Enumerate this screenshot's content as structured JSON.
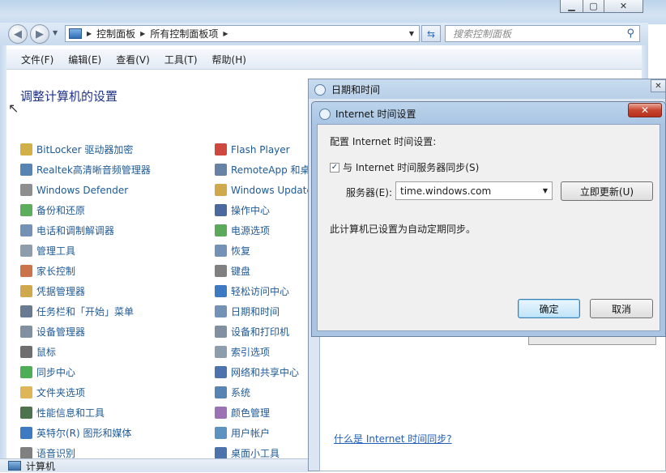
{
  "explorer": {
    "address_parts": [
      "控制面板",
      "所有控制面板项"
    ],
    "search_placeholder": "搜索控制面板",
    "menu": [
      "文件(F)",
      "编辑(E)",
      "查看(V)",
      "工具(T)",
      "帮助(H)"
    ],
    "page_title": "调整计算机的设置",
    "col1": [
      {
        "label": "BitLocker 驱动器加密",
        "icon": "key-icon",
        "color": "#c9a227"
      },
      {
        "label": "Realtek高清晰音频管理器",
        "icon": "speaker-icon",
        "color": "#3a6ea5"
      },
      {
        "label": "Windows Defender",
        "icon": "castle-icon",
        "color": "#7a7a7a"
      },
      {
        "label": "备份和还原",
        "icon": "backup-icon",
        "color": "#3f9f3f"
      },
      {
        "label": "电话和调制解调器",
        "icon": "modem-icon",
        "color": "#5a7fa8"
      },
      {
        "label": "管理工具",
        "icon": "tools-icon",
        "color": "#7a8c9e"
      },
      {
        "label": "家长控制",
        "icon": "parental-icon",
        "color": "#c25a2a"
      },
      {
        "label": "凭据管理器",
        "icon": "vault-icon",
        "color": "#c79a2c"
      },
      {
        "label": "任务栏和「开始」菜单",
        "icon": "taskbar-icon",
        "color": "#4d6480"
      },
      {
        "label": "设备管理器",
        "icon": "device-manager-icon",
        "color": "#6b7d8f"
      },
      {
        "label": "鼠标",
        "icon": "mouse-icon",
        "color": "#555555"
      },
      {
        "label": "同步中心",
        "icon": "sync-icon",
        "color": "#2f9f3a"
      },
      {
        "label": "文件夹选项",
        "icon": "folder-icon",
        "color": "#d8a93a"
      },
      {
        "label": "性能信息和工具",
        "icon": "performance-icon",
        "color": "#2d5b2d"
      },
      {
        "label": "英特尔(R) 图形和媒体",
        "icon": "intel-icon",
        "color": "#1c63b7"
      },
      {
        "label": "语音识别",
        "icon": "microphone-icon",
        "color": "#6a6a6a"
      }
    ],
    "col2": [
      {
        "label": "Flash Player",
        "icon": "flash-icon",
        "color": "#c4281c"
      },
      {
        "label": "RemoteApp 和桌",
        "icon": "remoteapp-icon",
        "color": "#4e6c95"
      },
      {
        "label": "Windows Update",
        "icon": "windows-update-icon",
        "color": "#c79a2c"
      },
      {
        "label": "操作中心",
        "icon": "flag-icon",
        "color": "#2d4f8c"
      },
      {
        "label": "电源选项",
        "icon": "power-icon",
        "color": "#3e9b3e"
      },
      {
        "label": "恢复",
        "icon": "recovery-icon",
        "color": "#5a7fa8"
      },
      {
        "label": "键盘",
        "icon": "keyboard-icon",
        "color": "#6a6a6a"
      },
      {
        "label": "轻松访问中心",
        "icon": "accessibility-icon",
        "color": "#1c63b7"
      },
      {
        "label": "日期和时间",
        "icon": "clock-icon",
        "color": "#5a7fa8"
      },
      {
        "label": "设备和打印机",
        "icon": "printer-icon",
        "color": "#6b7d8f"
      },
      {
        "label": "索引选项",
        "icon": "index-icon",
        "color": "#7a8c9e"
      },
      {
        "label": "网络和共享中心",
        "icon": "network-icon",
        "color": "#2d5b9c"
      },
      {
        "label": "系统",
        "icon": "system-icon",
        "color": "#3a6ea5"
      },
      {
        "label": "颜色管理",
        "icon": "color-icon",
        "color": "#8a5aa8"
      },
      {
        "label": "用户帐户",
        "icon": "users-icon",
        "color": "#3e7fb5"
      },
      {
        "label": "桌面小工具",
        "icon": "gadgets-icon",
        "color": "#2d5b9c"
      }
    ],
    "status_text": "计算机"
  },
  "datetime_dialog": {
    "title": "日期和时间",
    "link": "什么是 Internet 时间同步?"
  },
  "internet_time_dialog": {
    "title": "Internet 时间设置",
    "heading": "配置 Internet 时间设置:",
    "sync_checkbox_label": "与 Internet 时间服务器同步(S)",
    "sync_checked": true,
    "server_label": "服务器(E):",
    "server_value": "time.windows.com",
    "update_button": "立即更新(U)",
    "status_message": "此计算机已设置为自动定期同步。",
    "ok_button": "确定",
    "cancel_button": "取消"
  }
}
